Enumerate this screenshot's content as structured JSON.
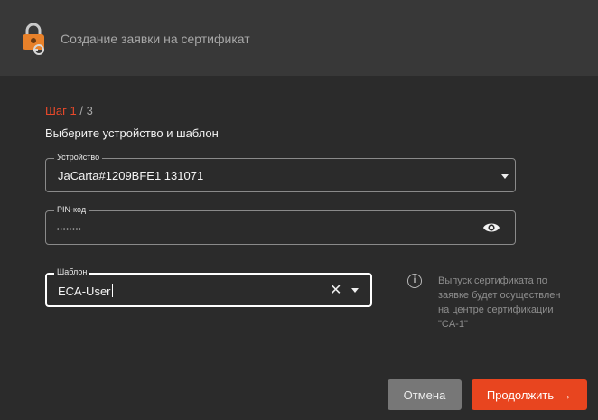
{
  "window": {
    "title": "Создание заявки на сертификат",
    "app_icon": "key-lock-app-icon"
  },
  "wizard": {
    "step_prefix": "Шаг 1",
    "step_suffix": " / 3",
    "subtitle": "Выберите устройство и шаблон"
  },
  "fields": {
    "device": {
      "label": "Устройство",
      "value": "JaCarta#1209BFE1 131071",
      "icon": "chevron-down-icon"
    },
    "pin": {
      "label": "PIN-код",
      "masked_value": "••••••••",
      "icon": "eye-icon"
    },
    "template": {
      "label": "Шаблон",
      "value": "ECA-User",
      "icons": [
        "clear-icon",
        "chevron-down-icon"
      ]
    }
  },
  "info": {
    "icon": "info-icon",
    "text": "Выпуск сертификата по заявке будет осуществлен на центре сертификации \"CA-1\""
  },
  "buttons": {
    "cancel": "Отмена",
    "continue": "Продолжить",
    "continue_icon": "arrow-right-icon"
  },
  "colors": {
    "accent": "#e8451f",
    "background": "#2b2b2b",
    "titlebar": "#383838"
  }
}
